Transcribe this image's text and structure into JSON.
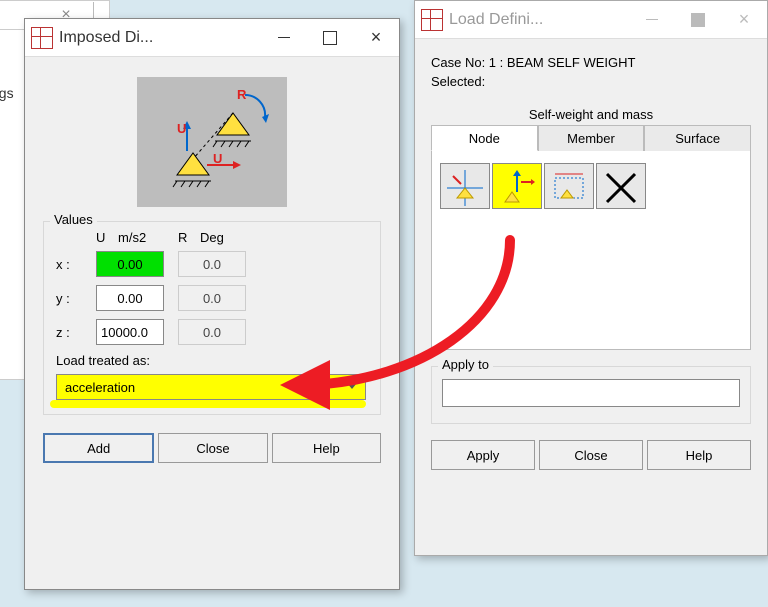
{
  "bg": {
    "tab_close": "×",
    "ngs_fragment": "ngs"
  },
  "left_dialog": {
    "title": "Imposed Di...",
    "values_group": "Values",
    "col_u": "U",
    "col_u_unit": "m/s2",
    "col_r": "R",
    "col_r_unit": "Deg",
    "rows": [
      {
        "label": "x :",
        "u": "0.00",
        "r": "0.0",
        "hl": true
      },
      {
        "label": "y :",
        "u": "0.00",
        "r": "0.0",
        "hl": false
      },
      {
        "label": "z :",
        "u": "10000.0",
        "r": "0.0",
        "hl": false
      }
    ],
    "load_treated_label": "Load treated as:",
    "load_treated_value": "acceleration",
    "btn_add": "Add",
    "btn_close": "Close",
    "btn_help": "Help"
  },
  "right_dialog": {
    "title": "Load Defini...",
    "case_label": "Case No: 1 : BEAM SELF WEIGHT",
    "selected_label": "Selected:",
    "tabset_title": "Self-weight and mass",
    "tabs": [
      "Node",
      "Member",
      "Surface"
    ],
    "active_tab": 0,
    "highlighted_icon": 1,
    "apply_to_label": "Apply to",
    "apply_to_value": "",
    "btn_apply": "Apply",
    "btn_close": "Close",
    "btn_help": "Help"
  }
}
